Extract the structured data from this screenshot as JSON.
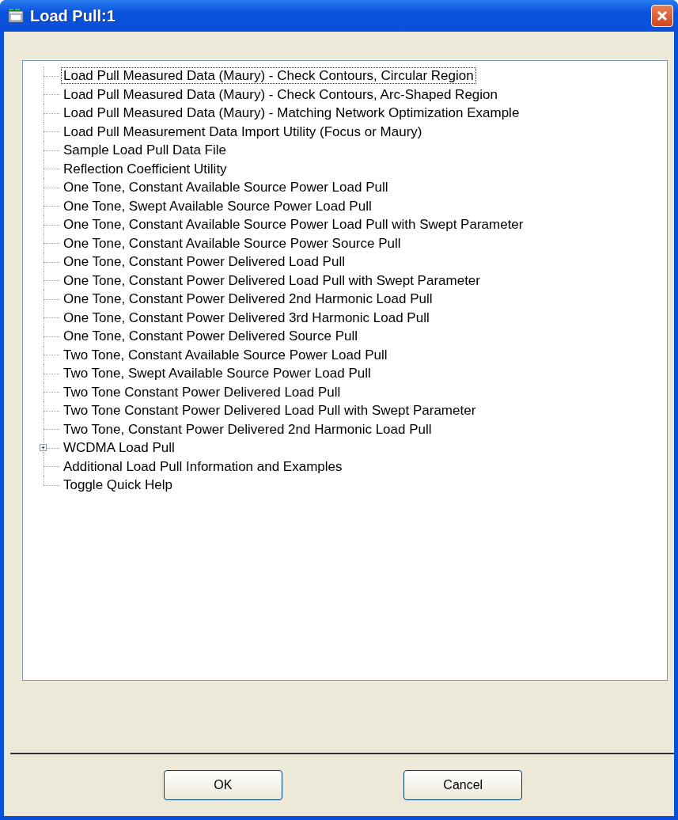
{
  "window": {
    "title": "Load Pull:1"
  },
  "tree": {
    "items": [
      {
        "label": "Load Pull Measured Data (Maury) - Check Contours, Circular Region",
        "kind": "leaf",
        "selected": true
      },
      {
        "label": "Load Pull Measured Data (Maury) - Check Contours, Arc-Shaped Region",
        "kind": "leaf",
        "selected": false
      },
      {
        "label": "Load Pull Measured Data (Maury) - Matching Network Optimization Example",
        "kind": "leaf",
        "selected": false
      },
      {
        "label": "Load Pull Measurement Data Import Utility (Focus or Maury)",
        "kind": "leaf",
        "selected": false
      },
      {
        "label": "Sample Load Pull Data File",
        "kind": "leaf",
        "selected": false
      },
      {
        "label": "Reflection Coefficient Utility",
        "kind": "leaf",
        "selected": false
      },
      {
        "label": "One Tone, Constant Available Source Power Load Pull",
        "kind": "leaf",
        "selected": false
      },
      {
        "label": "One Tone, Swept Available Source Power Load Pull",
        "kind": "leaf",
        "selected": false
      },
      {
        "label": "One Tone, Constant Available Source Power Load Pull with Swept Parameter",
        "kind": "leaf",
        "selected": false
      },
      {
        "label": "One Tone, Constant Available Source Power Source Pull",
        "kind": "leaf",
        "selected": false
      },
      {
        "label": "One Tone, Constant Power Delivered Load Pull",
        "kind": "leaf",
        "selected": false
      },
      {
        "label": "One Tone, Constant Power Delivered Load Pull with Swept Parameter",
        "kind": "leaf",
        "selected": false
      },
      {
        "label": "One Tone, Constant Power Delivered 2nd Harmonic Load Pull",
        "kind": "leaf",
        "selected": false
      },
      {
        "label": "One Tone, Constant Power Delivered 3rd Harmonic Load Pull",
        "kind": "leaf",
        "selected": false
      },
      {
        "label": "One Tone, Constant Power Delivered Source Pull",
        "kind": "leaf",
        "selected": false
      },
      {
        "label": "Two Tone, Constant Available Source Power Load Pull",
        "kind": "leaf",
        "selected": false
      },
      {
        "label": "Two Tone, Swept Available Source Power Load Pull",
        "kind": "leaf",
        "selected": false
      },
      {
        "label": "Two Tone Constant Power Delivered Load Pull",
        "kind": "leaf",
        "selected": false
      },
      {
        "label": "Two Tone Constant Power Delivered Load Pull with Swept Parameter",
        "kind": "leaf",
        "selected": false
      },
      {
        "label": "Two Tone, Constant Power Delivered 2nd Harmonic Load Pull",
        "kind": "leaf",
        "selected": false
      },
      {
        "label": "WCDMA Load Pull",
        "kind": "folder",
        "selected": false,
        "expanded": false
      },
      {
        "label": "Additional Load Pull Information and Examples",
        "kind": "leaf",
        "selected": false
      },
      {
        "label": "Toggle Quick Help",
        "kind": "leaf",
        "selected": false
      }
    ]
  },
  "buttons": [
    {
      "label": "OK"
    },
    {
      "label": "Cancel"
    }
  ]
}
